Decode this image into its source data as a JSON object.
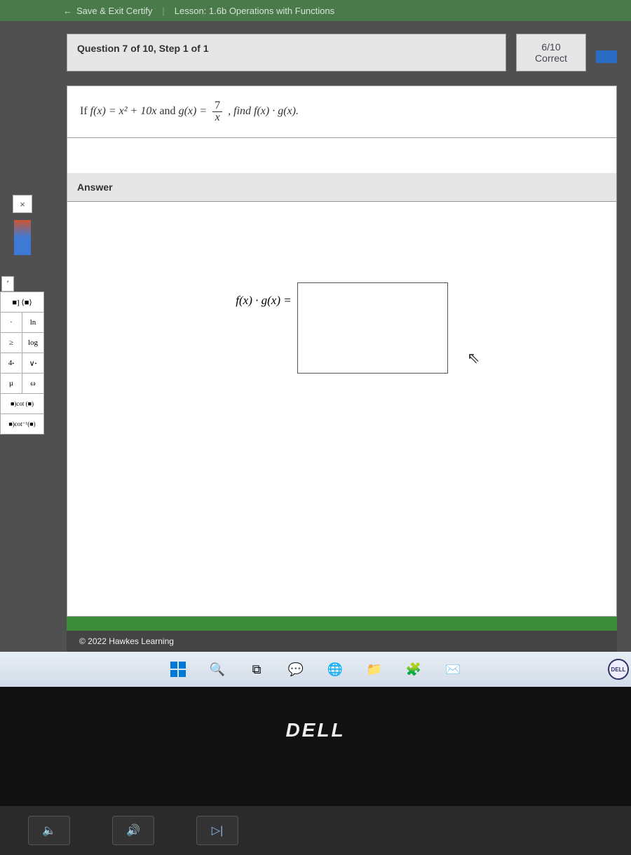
{
  "topbar": {
    "save_exit": "Save & Exit Certify",
    "lesson": "Lesson: 1.6b Operations with Functions"
  },
  "header": {
    "question": "Question 7 of 10, Step 1 of 1",
    "score": "6/10",
    "correct": "Correct"
  },
  "problem": {
    "prefix": "If ",
    "fdef": "f(x) = x² + 10x",
    "and": " and ",
    "gdef_pre": "g(x) = ",
    "frac_top": "7",
    "frac_bot": "x",
    "find": ", find f(x) · g(x)."
  },
  "answer": {
    "title": "Answer",
    "label": "f(x) · g(x) ="
  },
  "keypad": {
    "close": "×",
    "prime": "′",
    "bracket": "■] ⟨■⟩",
    "ln": "ln",
    "ge": "≥",
    "log": "log",
    "a4": "4",
    "vdot": "∨",
    "mu": "μ",
    "omega": "ω",
    "cot1": "cot (■)",
    "cot2": "cot⁻¹(■)"
  },
  "footer": {
    "copyright": "© 2022 Hawkes Learning"
  },
  "bezel": {
    "brand": "DELL"
  },
  "badge": "DELL"
}
